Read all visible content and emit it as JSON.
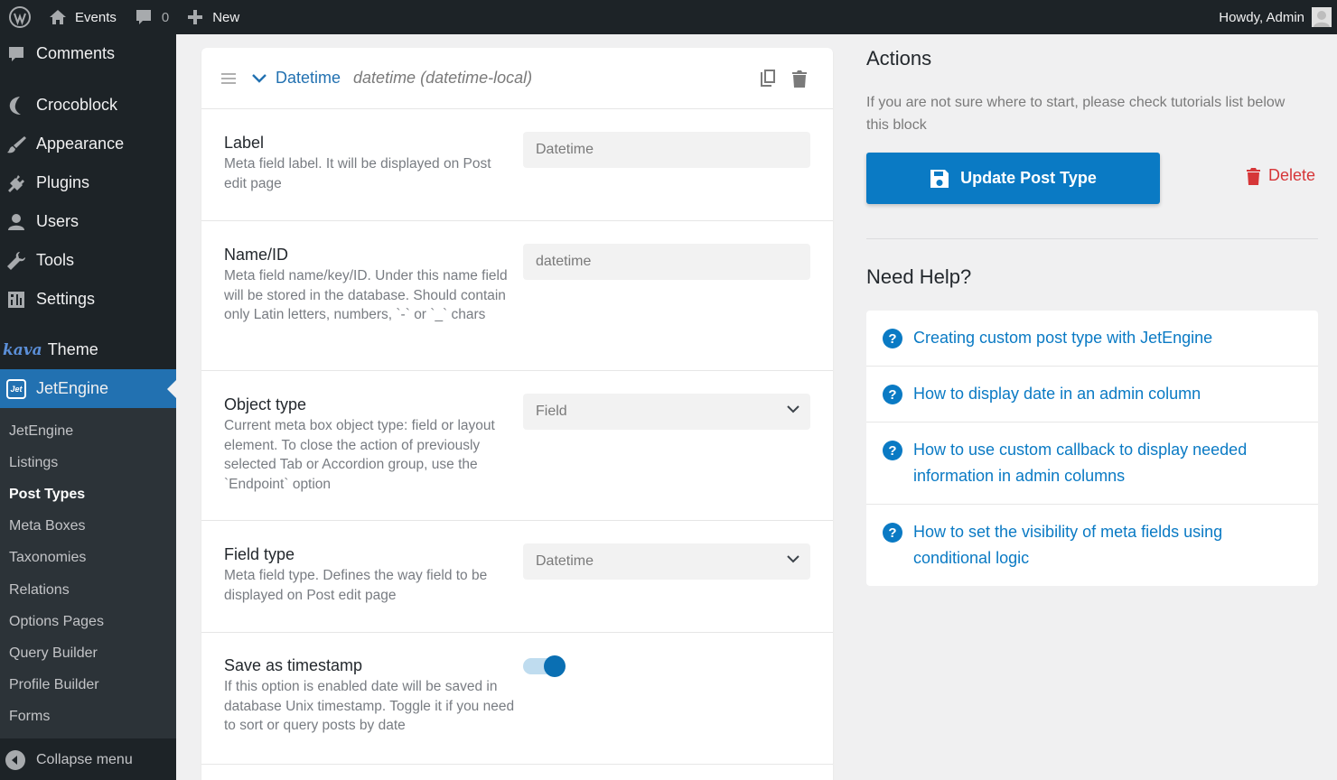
{
  "adminbar": {
    "site_name": "Events",
    "comments_count": "0",
    "new_label": "New",
    "greeting": "Howdy, Admin"
  },
  "sidebar": {
    "items": [
      {
        "label": "Comments",
        "icon": "comment-icon"
      },
      {
        "label": "Crocoblock",
        "icon": "crocoblock-icon"
      },
      {
        "label": "Appearance",
        "icon": "brush-icon"
      },
      {
        "label": "Plugins",
        "icon": "plug-icon"
      },
      {
        "label": "Users",
        "icon": "user-icon"
      },
      {
        "label": "Tools",
        "icon": "wrench-icon"
      },
      {
        "label": "Settings",
        "icon": "settings-icon"
      }
    ],
    "kava_logo": "kava",
    "kava_label": "Theme",
    "jet_logo": "Jet",
    "active_label": "JetEngine",
    "submenu": [
      "JetEngine",
      "Listings",
      "Post Types",
      "Meta Boxes",
      "Taxonomies",
      "Relations",
      "Options Pages",
      "Query Builder",
      "Profile Builder",
      "Forms"
    ],
    "current_submenu": "Post Types",
    "collapse_label": "Collapse menu"
  },
  "field_card": {
    "title": "Datetime",
    "subtitle": "datetime (datetime-local)",
    "rows": {
      "label": {
        "label": "Label",
        "desc": "Meta field label. It will be displayed on Post edit page",
        "placeholder": "Datetime"
      },
      "name": {
        "label": "Name/ID",
        "desc": "Meta field name/key/ID. Under this name field will be stored in the database. Should contain only Latin letters, numbers, `-` or `_` chars",
        "placeholder": "datetime"
      },
      "object_type": {
        "label": "Object type",
        "desc": "Current meta box object type: field or layout element. To close the action of previously selected Tab or Accordion group, use the `Endpoint` option",
        "value": "Field"
      },
      "field_type": {
        "label": "Field type",
        "desc": "Meta field type. Defines the way field to be displayed on Post edit page",
        "value": "Datetime"
      },
      "timestamp": {
        "label": "Save as timestamp",
        "desc": "If this option is enabled date will be saved in database Unix timestamp. Toggle it if you need to sort or query posts by date",
        "enabled": true
      }
    }
  },
  "actions": {
    "title": "Actions",
    "desc": "If you are not sure where to start, please check tutorials list below this block",
    "update_label": "Update Post Type",
    "delete_label": "Delete"
  },
  "help": {
    "title": "Need Help?",
    "links": [
      "Creating custom post type with JetEngine",
      "How to display date in an admin column",
      "How to use custom callback to display needed information in admin columns",
      "How to set the visibility of meta fields using conditional logic"
    ]
  },
  "colors": {
    "accent": "#2271b1",
    "button": "#0a7ac4",
    "danger": "#d63638",
    "sidebar": "#1d2327"
  }
}
